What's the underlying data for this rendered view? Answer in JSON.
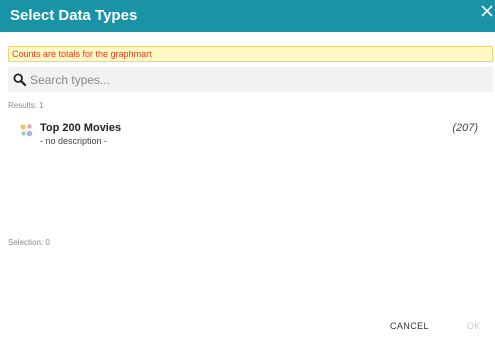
{
  "dialog": {
    "title": "Select Data Types",
    "notice": "Counts are totals for the graphmart"
  },
  "search": {
    "placeholder": "Search types...",
    "value": ""
  },
  "results": {
    "count_label": "Results: 1",
    "items": [
      {
        "name": "Top 200 Movies",
        "description": "- no description -",
        "count": "(207)"
      }
    ]
  },
  "selection": {
    "count_label": "Selection: 0"
  },
  "buttons": {
    "cancel_label": "CANCEL",
    "ok_label": "OK"
  },
  "colors": {
    "header_bg": "#1a93a6",
    "notice_bg": "#fef9c6",
    "notice_border": "#f2d36a",
    "notice_text": "#d9431e",
    "disabled_text": "#c8c8c8"
  },
  "icons": {
    "close": "close-icon",
    "search": "search-icon",
    "type": "data-type-icon"
  }
}
